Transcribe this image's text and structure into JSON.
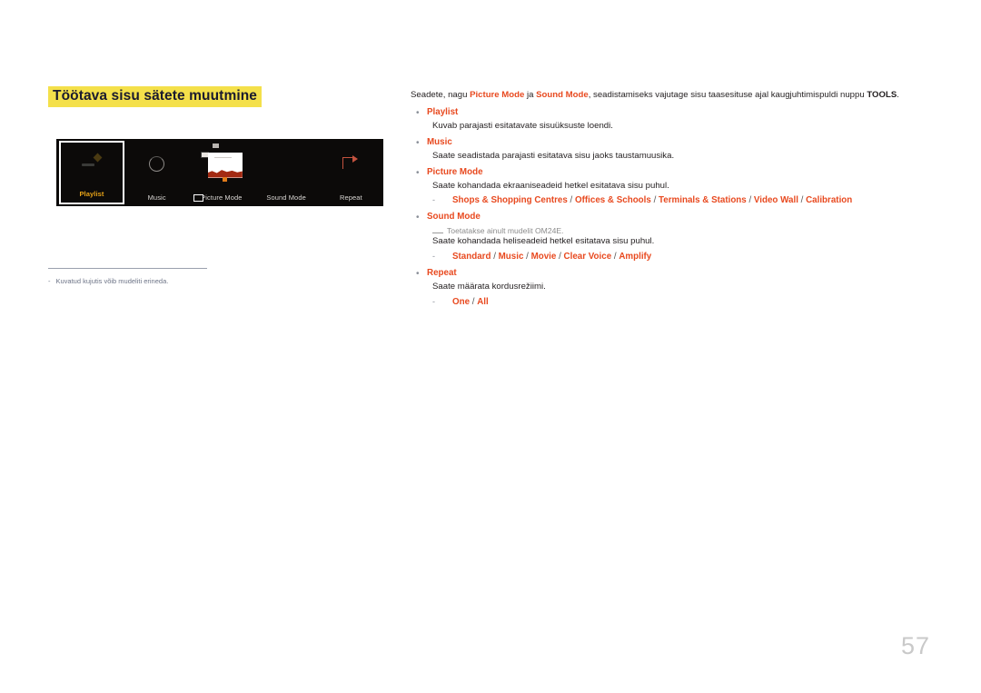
{
  "document": {
    "page_number": "57"
  },
  "section": {
    "title": "Töötava sisu sätete muutmine"
  },
  "device_panel": {
    "items": [
      {
        "label": "Playlist",
        "icon": "playlist-icon",
        "selected": true
      },
      {
        "label": "Music",
        "icon": "music-note-icon",
        "selected": false
      },
      {
        "label": "Picture Mode",
        "icon": "picture-thumbnail-icon",
        "selected": false
      },
      {
        "label": "Sound Mode",
        "icon": "sound-mode-icon",
        "selected": false
      },
      {
        "label": "Repeat",
        "icon": "repeat-arrow-icon",
        "selected": false
      }
    ]
  },
  "figure_footnote": {
    "dash": "-",
    "text": "Kuvatud kujutis võib mudeliti erineda."
  },
  "content": {
    "intro": {
      "part1": "Seadete, nagu ",
      "accent1": "Picture Mode",
      "part2": " ja ",
      "accent2": "Sound Mode",
      "part3": ", seadistamiseks vajutage sisu taasesituse ajal kaugjuhtimispuldi nuppu ",
      "bold_key": "TOOLS",
      "part4": "."
    },
    "bullet_char": "•",
    "dash_char": "-",
    "items": [
      {
        "heading": "Playlist",
        "description": "Kuvab parajasti esitatavate sisuüksuste loendi."
      },
      {
        "heading": "Music",
        "description": "Saate seadistada parajasti esitatava sisu jaoks taustamuusika."
      },
      {
        "heading": "Picture Mode",
        "description": "Saate kohandada ekraaniseadeid hetkel esitatava sisu puhul.",
        "options": [
          "Shops & Shopping Centres",
          "Offices & Schools",
          "Terminals & Stations",
          "Video Wall",
          "Calibration"
        ]
      },
      {
        "heading": "Sound Mode",
        "note": "Toetatakse ainult mudelit OM24E.",
        "description": "Saate kohandada heliseadeid hetkel esitatava sisu puhul.",
        "options": [
          "Standard",
          "Music",
          "Movie",
          "Clear Voice",
          "Amplify"
        ]
      },
      {
        "heading": "Repeat",
        "description": "Saate määrata kordusrežiimi.",
        "options": [
          "One",
          "All"
        ]
      }
    ]
  },
  "colors": {
    "accent": "#e8491f",
    "highlight": "#f4e04a",
    "title_text": "#1a1a2e",
    "note_gray": "#8c8c8c",
    "footnote_blue_gray": "#6d7487",
    "page_number_gray": "#c9c9c9",
    "panel_bg": "#0c0a09",
    "selected_label": "#e8a317"
  }
}
